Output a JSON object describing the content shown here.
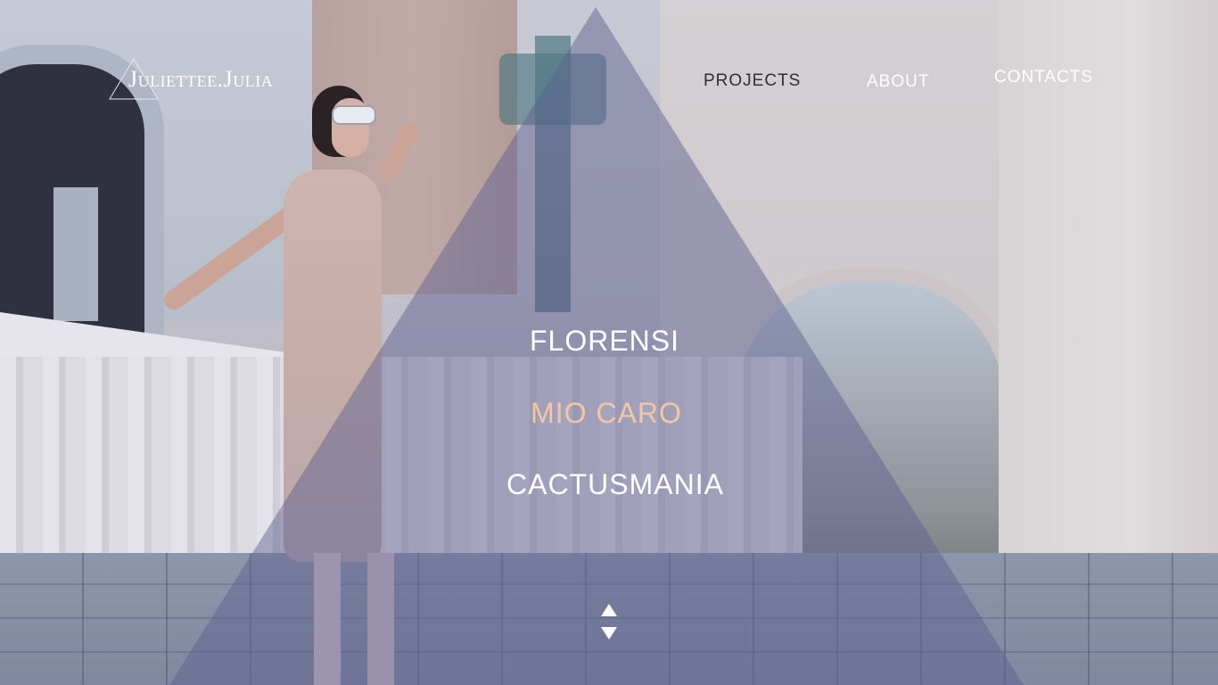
{
  "header": {
    "logo_text": "Juliettee.Julia"
  },
  "nav": {
    "items": [
      {
        "label": "PROJECTS"
      },
      {
        "label": "ABOUT"
      },
      {
        "label": "CONTACTS"
      }
    ]
  },
  "projects": {
    "items": [
      {
        "label": "FLORENSI"
      },
      {
        "label": "MIO CARO"
      },
      {
        "label": "CACTUSMANIA"
      }
    ]
  },
  "colors": {
    "accent": "#f4c7a3",
    "overlay": "#6a6b92",
    "nav_active": "#2e2d3a",
    "text_light": "#ffffff"
  },
  "icons": {
    "logo_mark": "triangle-outline-icon",
    "scroll_up": "triangle-up-icon",
    "scroll_down": "triangle-down-icon"
  }
}
